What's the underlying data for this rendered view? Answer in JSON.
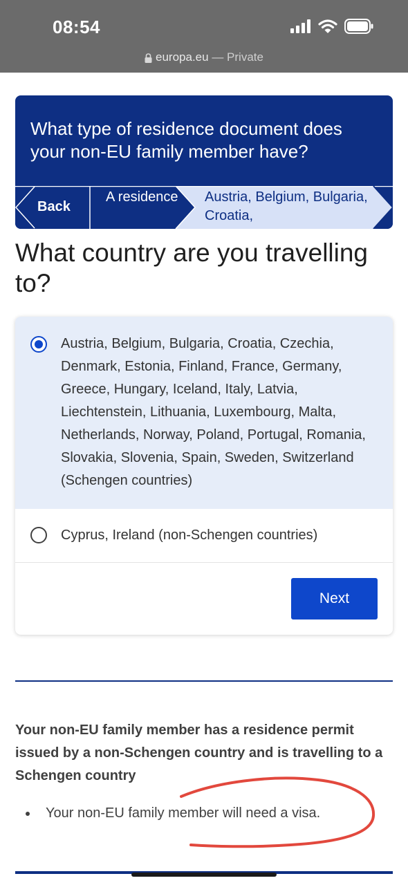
{
  "status_bar": {
    "time": "08:54",
    "url": "europa.eu",
    "separator": " — ",
    "mode": "Private",
    "icons": [
      "signal-icon",
      "wifi-icon",
      "battery-icon",
      "lock-icon"
    ]
  },
  "header": {
    "question": "What type of residence document does your non-EU family member have?",
    "breadcrumb": {
      "back": "Back",
      "residence": "A residence",
      "countries": "Austria, Belgium, Bulgaria, Croatia,"
    }
  },
  "main": {
    "question": "What country are you travelling to?",
    "options": [
      {
        "label": "Austria, Belgium, Bulgaria, Croatia, Czechia, Denmark, Estonia, Finland, France, Germany, Greece, Hungary, Iceland, Italy, Latvia, Liechtenstein, Lithuania, Luxembourg, Malta, Netherlands, Norway, Poland, Portugal, Romania, Slovakia, Slovenia, Spain, Sweden, Switzerland (Schengen countries)",
        "selected": true
      },
      {
        "label": "Cyprus, Ireland (non-Schengen countries)",
        "selected": false
      }
    ],
    "next_label": "Next"
  },
  "result": {
    "title": "Your non-EU family member has a residence permit issued by a non-Schengen country and is travelling to a Schengen country",
    "items": [
      "Your non-EU family member will need a visa."
    ]
  },
  "colors": {
    "status_bar": "#6b6b6b",
    "header_blue": "#0e2f83",
    "button_blue": "#0e47cb",
    "selected_bg": "#e6edf9",
    "breadcrumb_active": "#d7e1f7",
    "annotation_red": "#e2483d"
  }
}
